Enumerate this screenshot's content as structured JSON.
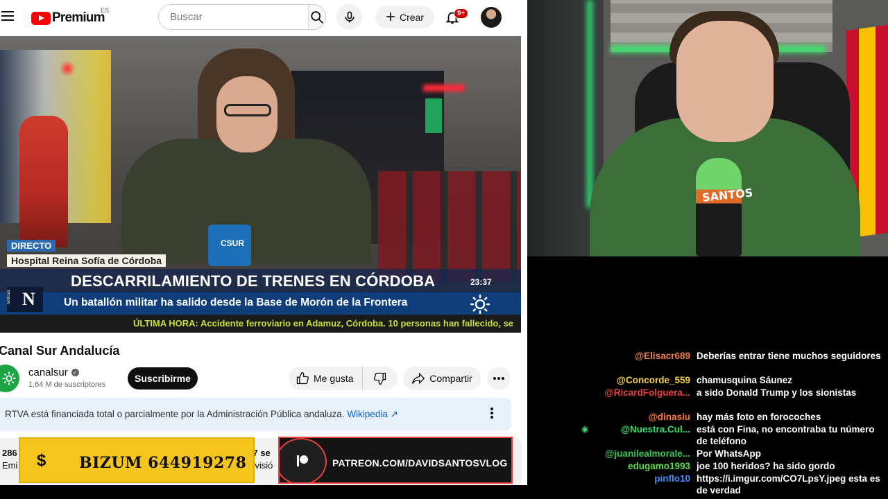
{
  "youtube": {
    "logo": "Premium",
    "logo_region": "ES",
    "search_placeholder": "Buscar",
    "create_label": "Crear",
    "notif_badge": "9+",
    "video": {
      "live_tag": "DIRECTO",
      "location": "Hospital Reina Sofía de Córdoba",
      "headline": "DESCARRILAMIENTO DE TRENES EN CÓRDOBA",
      "subheadline": "Un batallón militar ha salido desde la Base de Morón de la Frontera",
      "clock": "23:37",
      "ticker": "ÚLTIMA HORA: Accidente ferroviario en Adamuz, Córdoba. 10 personas  han fallecido, se",
      "network_label": "Noticias",
      "mic_label": "CSUR"
    },
    "channel": {
      "title": "Canal Sur Andalucía",
      "name": "canalsur",
      "subscribers": "1,64 M de suscriptores",
      "subscribe_label": "Suscribirme"
    },
    "actions": {
      "like_label": "Me gusta",
      "share_label": "Compartir"
    },
    "info_panel": {
      "text": "RTVA está financiada total o parcialmente por la Administración Pública andaluza.",
      "link": "Wikipedia"
    },
    "description": {
      "views_partial": "286",
      "line2_partial": "Emi",
      "date_partial": "el 7 se",
      "line4_partial": "elevisió"
    }
  },
  "overlays": {
    "bizum_symbol": "$",
    "bizum": "BIZUM 644919278",
    "patreon": "PATREON.COM/DAVIDSANTOSVLOG"
  },
  "webcam": {
    "mic_brand": "SANTOS"
  },
  "chat": {
    "messages": [
      {
        "user": "@Elisacr689",
        "color": "#f07e4f",
        "text": "Deberías entrar tiene muchos seguidores"
      },
      {
        "user": "@Concorde_559",
        "color": "#f5d33d",
        "text": "chamusquina Sáunez"
      },
      {
        "user": "@RicardFolguera...",
        "color": "#e8423c",
        "text": "a sido Donald Trump y los sionistas"
      },
      {
        "user": "@dinasiu",
        "color": "#ff7a3a",
        "text": "hay más foto en forocoches"
      },
      {
        "user": "@Nuestra.Cul...",
        "color": "#2ee06a",
        "text": "está con Fina, no encontraba tu número de teléfono"
      },
      {
        "user": "@juanilealmorale...",
        "color": "#37c653",
        "text": "Por WhatsApp"
      },
      {
        "user": "edugamo1993",
        "color": "#5fe04a",
        "text": "joe 100 heridos? ha sido gordo"
      },
      {
        "user": "pinflo10",
        "color": "#3f8cff",
        "text": "https://i.imgur.com/CO7LpsY.jpeg esta es de verdad"
      }
    ]
  }
}
